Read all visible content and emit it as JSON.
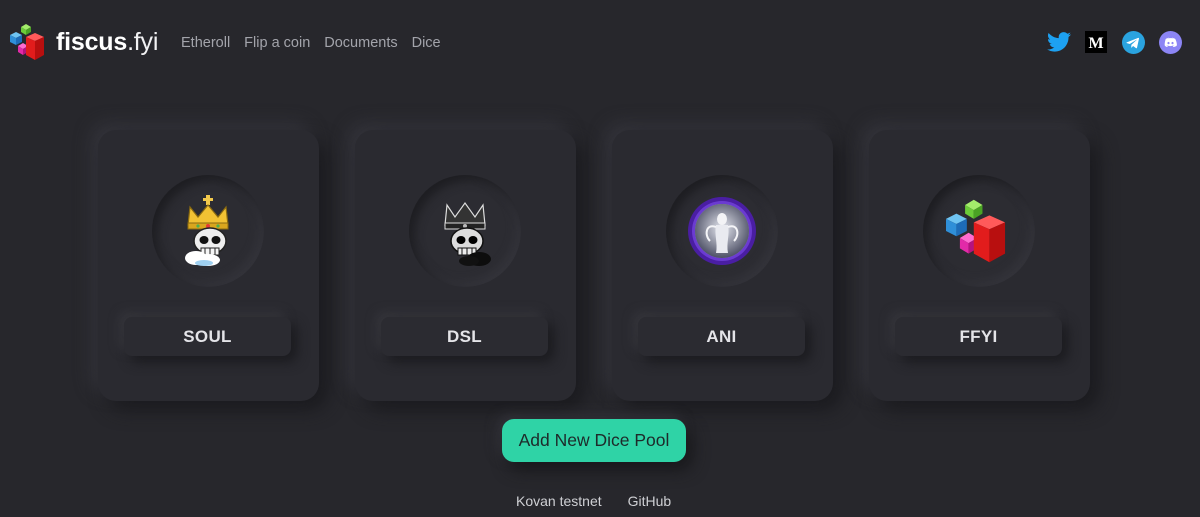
{
  "brand": {
    "name_bold": "fiscus",
    "name_light": ".fyi"
  },
  "nav": {
    "items": [
      {
        "label": "Etheroll"
      },
      {
        "label": "Flip a coin"
      },
      {
        "label": "Documents"
      },
      {
        "label": "Dice"
      }
    ]
  },
  "social": [
    {
      "icon": "twitter-icon"
    },
    {
      "icon": "medium-icon"
    },
    {
      "icon": "telegram-icon"
    },
    {
      "icon": "discord-icon"
    }
  ],
  "tokens": [
    {
      "label": "SOUL",
      "icon": "skull-king-icon"
    },
    {
      "label": "DSL",
      "icon": "dark-skull-king-icon"
    },
    {
      "label": "ANI",
      "icon": "angel-medallion-icon"
    },
    {
      "label": "FFYI",
      "icon": "cubes-logo-icon"
    }
  ],
  "cta": {
    "label": "Add New Dice Pool"
  },
  "footer": {
    "links": [
      {
        "label": "Kovan testnet"
      },
      {
        "label": "GitHub"
      }
    ]
  },
  "colors": {
    "background": "#27272c",
    "accent": "#2fd3a6",
    "nav_text": "#a3a4ab",
    "twitter": "#1da1f2",
    "telegram": "#2aa3df",
    "discord": "#8c85f5"
  }
}
